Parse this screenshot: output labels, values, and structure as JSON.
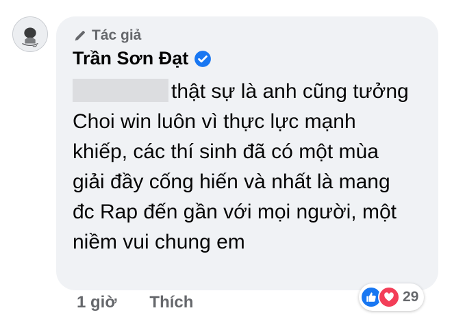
{
  "comment": {
    "badge_label": "Tác giả",
    "author_name": "Trần Sơn Đạt",
    "text": "thật sự là anh cũng tưởng Choi win luôn vì thực lực mạnh khiếp, các thí sinh đã có một mùa giải đầy cống hiến và nhất là mang đc Rap đến gần với mọi người, một niềm vui chung em"
  },
  "actions": {
    "time": "1 giờ",
    "like_label": "Thích"
  },
  "reactions": {
    "icons": [
      "like-icon",
      "love-icon"
    ],
    "count": "29"
  },
  "colors": {
    "bubble": "#f0f2f5",
    "meta_text": "#65676b",
    "body_text": "#050505",
    "verified": "#1877f2",
    "like": "#1877f2",
    "love": "#f33e58"
  }
}
